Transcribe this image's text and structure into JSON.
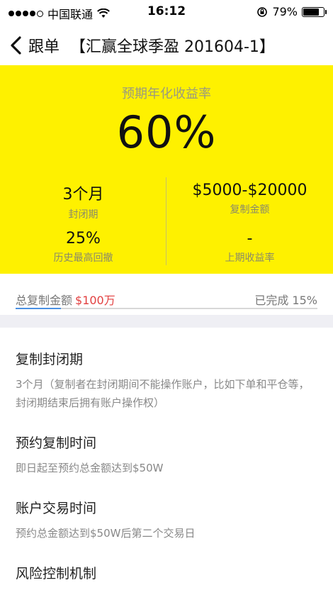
{
  "status_bar": {
    "carrier": "中国联通",
    "time": "16:12",
    "battery": "79%",
    "battery_level": 0.79
  },
  "nav": {
    "back_label": "跟单",
    "title": "【汇赢全球季盈 201604-1】"
  },
  "hero": {
    "rate_label": "预期年化收益率",
    "rate_value": "60%",
    "stats": [
      {
        "value": "3个月",
        "label": "封闭期"
      },
      {
        "value": "$5000-$20000",
        "label": "复制金额"
      },
      {
        "value": "25%",
        "label": "历史最高回撤"
      },
      {
        "value": "-",
        "label": "上期收益率"
      }
    ]
  },
  "progress": {
    "total_label": "总复制金额",
    "total_amount": "$100万",
    "done_label": "已完成 15%",
    "fraction": 0.15,
    "fill_color": "#4a90e2"
  },
  "sections": [
    {
      "title": "复制封闭期",
      "desc": "3个月（复制者在封闭期间不能操作账户，比如下单和平仓等，封闭期结束后拥有账户操作权）"
    },
    {
      "title": "预约复制时间",
      "desc": "即日起至预约总金额达到$50W"
    },
    {
      "title": "账户交易时间",
      "desc": "预约总金额达到$50W后第二个交易日"
    },
    {
      "title": "风险控制机制",
      "desc": ""
    }
  ],
  "colors": {
    "hero_background": "#fef100",
    "amount_red": "#e23f3f"
  }
}
